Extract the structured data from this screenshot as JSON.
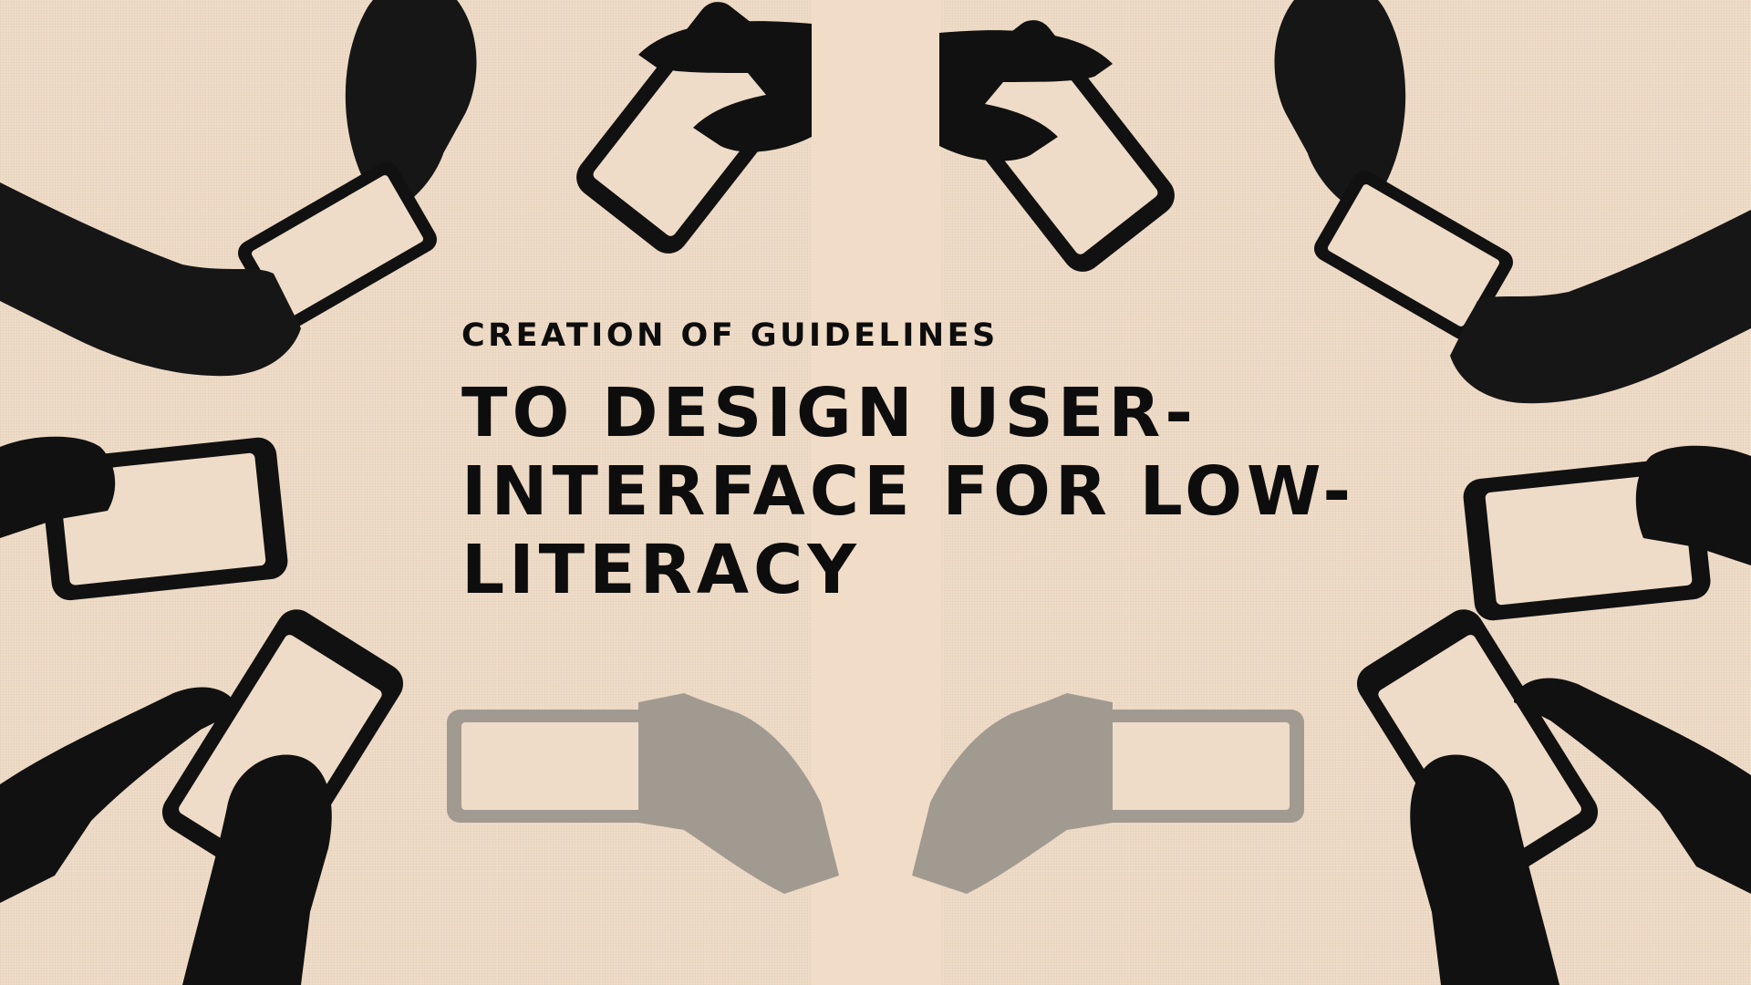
{
  "slide": {
    "eyebrow": "CREATION OF GUIDELINES",
    "headline_lines": [
      "TO DESIGN USER-",
      "INTERFACE FOR LOW-",
      "LITERACY"
    ]
  },
  "colors": {
    "background": "#efdcc8",
    "ink": "#111111",
    "shadow": "#a19a91"
  },
  "icons": [
    "hand-holding-phone-icon",
    "pointing-hand-icon",
    "phone-shadow-icon"
  ]
}
